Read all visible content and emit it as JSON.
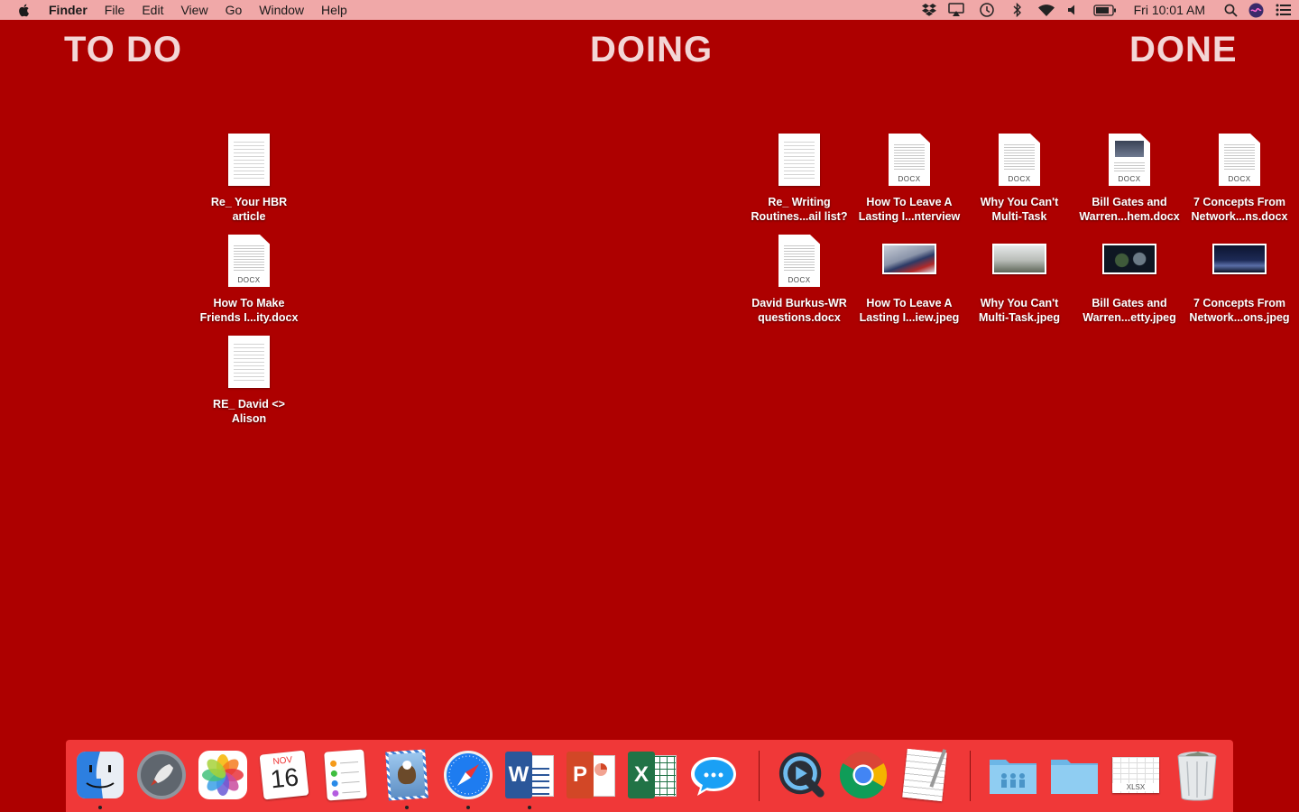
{
  "menubar": {
    "app_name": "Finder",
    "menus": [
      "File",
      "Edit",
      "View",
      "Go",
      "Window",
      "Help"
    ],
    "clock": "Fri 10:01 AM"
  },
  "columns": {
    "todo": "TO DO",
    "doing": "DOING",
    "done": "DONE"
  },
  "todo_files": [
    {
      "line1": "Re_ Your HBR",
      "line2": "article"
    },
    {
      "line1": "How To Make",
      "line2": "Friends I...ity.docx",
      "badge": "DOCX"
    },
    {
      "line1": "RE_ David <>",
      "line2": "Alison"
    }
  ],
  "done_files": [
    {
      "line1": "Re_ Writing",
      "line2": "Routines...ail list?"
    },
    {
      "line1": "How To Leave A",
      "line2": "Lasting I...nterview",
      "badge": "DOCX"
    },
    {
      "line1": "Why You Can't",
      "line2": "Multi-Task",
      "badge": "DOCX"
    },
    {
      "line1": "Bill Gates and",
      "line2": "Warren...hem.docx",
      "badge": "DOCX"
    },
    {
      "line1": "7 Concepts From",
      "line2": "Network...ns.docx",
      "badge": "DOCX"
    },
    {
      "line1": "David Burkus-WR",
      "line2": "questions.docx",
      "badge": "DOCX"
    },
    {
      "line1": "How To Leave A",
      "line2": "Lasting I...iew.jpeg"
    },
    {
      "line1": "Why You Can't",
      "line2": "Multi-Task.jpeg"
    },
    {
      "line1": "Bill Gates and",
      "line2": "Warren...etty.jpeg"
    },
    {
      "line1": "7 Concepts From",
      "line2": "Network...ons.jpeg"
    }
  ],
  "dock": {
    "calendar_month": "NOV",
    "calendar_day": "16",
    "word_letter": "W",
    "powerpoint_letter": "P",
    "excel_letter": "X",
    "xlsx_badge": "XLSX"
  }
}
